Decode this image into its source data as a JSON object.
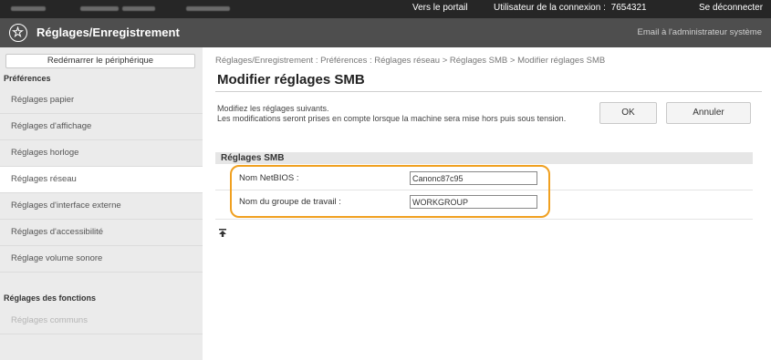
{
  "topbar": {
    "portal_link": "Vers le portail",
    "user_label": "Utilisateur de la connexion :",
    "user_id": "7654321",
    "logout_link": "Se déconnecter"
  },
  "header": {
    "title": "Réglages/Enregistrement",
    "email_admin": "Email à l'administrateur système",
    "logo_icon": "settings-register-icon"
  },
  "sidebar": {
    "restart_button": "Redémarrer le périphérique",
    "preferences_heading": "Préférences",
    "items": [
      {
        "label": "Réglages papier"
      },
      {
        "label": "Réglages d'affichage"
      },
      {
        "label": "Réglages horloge"
      },
      {
        "label": "Réglages réseau"
      },
      {
        "label": "Réglages d'interface externe"
      },
      {
        "label": "Réglages d'accessibilité"
      },
      {
        "label": "Réglage volume sonore"
      }
    ],
    "functions_heading": "Réglages des fonctions",
    "functions_items": [
      {
        "label": "Réglages communs"
      }
    ]
  },
  "main": {
    "breadcrumb": "Réglages/Enregistrement : Préférences : Réglages réseau > Réglages SMB > Modifier réglages SMB",
    "title": "Modifier réglages SMB",
    "intro_line1": "Modifiez les réglages suivants.",
    "intro_line2": "Les modifications seront prises en compte lorsque la machine sera mise hors puis sous tension.",
    "ok_button": "OK",
    "cancel_button": "Annuler",
    "section_title": "Réglages SMB",
    "fields": [
      {
        "label": "Nom NetBIOS :",
        "value": "Canonc87c95"
      },
      {
        "label": "Nom du groupe de travail :",
        "value": "WORKGROUP"
      }
    ],
    "top_icon": "scroll-to-top-icon"
  }
}
